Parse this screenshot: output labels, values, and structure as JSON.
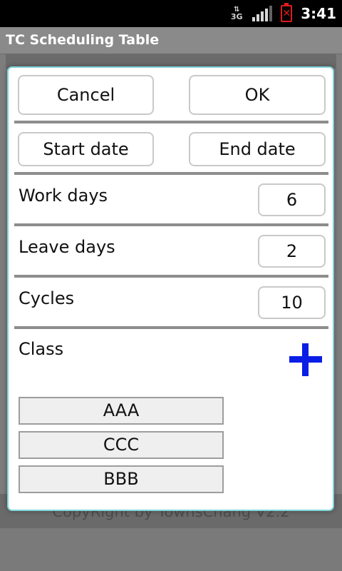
{
  "status_bar": {
    "network": "3G",
    "icons": [
      "network-3g-icon",
      "signal-icon",
      "battery-alert-icon"
    ],
    "time": "3:41",
    "battery_color": "#e01b1b"
  },
  "app": {
    "title": "TC Scheduling Table",
    "footer": "CopyRight by TownsChang  V2.2"
  },
  "dialog": {
    "cancel_label": "Cancel",
    "ok_label": "OK",
    "start_date_label": "Start date",
    "end_date_label": "End date",
    "work_days": {
      "label": "Work days",
      "value": "6"
    },
    "leave_days": {
      "label": "Leave days",
      "value": "2"
    },
    "cycles": {
      "label": "Cycles",
      "value": "10"
    },
    "class": {
      "label": "Class",
      "add_icon": "plus-icon",
      "add_color": "#0a1ee6",
      "items": [
        "AAA",
        "CCC",
        "BBB"
      ]
    }
  }
}
